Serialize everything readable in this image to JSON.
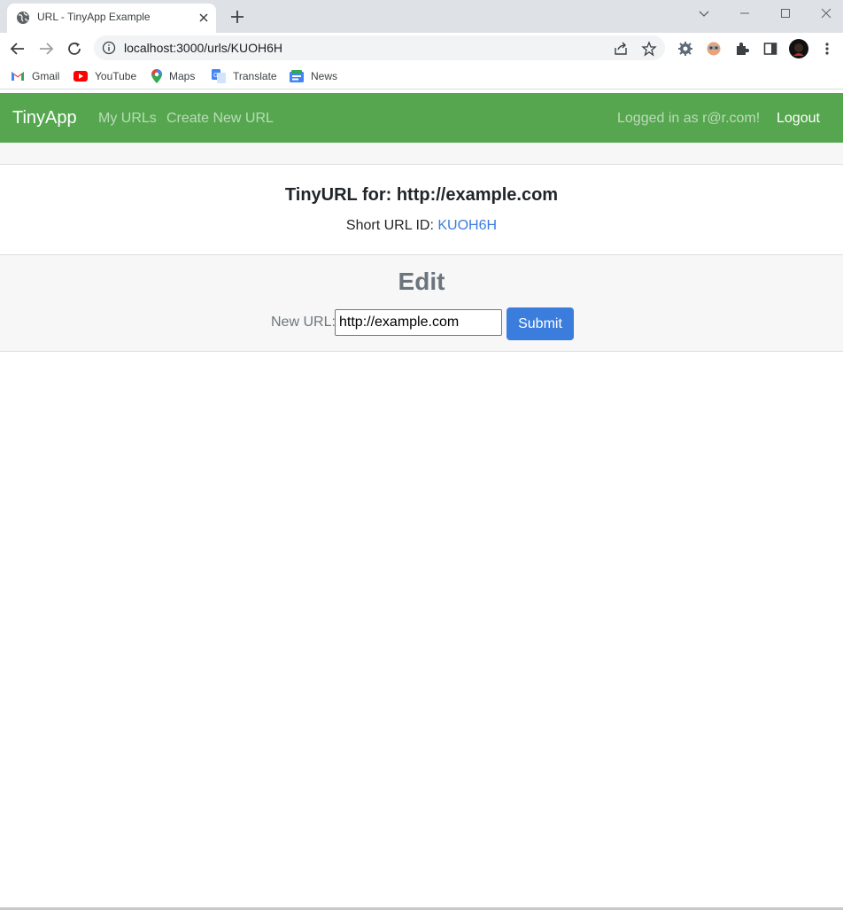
{
  "browser": {
    "tab": {
      "title": "URL - TinyApp Example",
      "favicon": "globe-icon"
    },
    "address_bar": {
      "url": "localhost:3000/urls/KUOH6H"
    },
    "bookmarks": [
      {
        "label": "Gmail",
        "icon": "gmail-icon"
      },
      {
        "label": "YouTube",
        "icon": "youtube-icon"
      },
      {
        "label": "Maps",
        "icon": "maps-icon"
      },
      {
        "label": "Translate",
        "icon": "translate-icon"
      },
      {
        "label": "News",
        "icon": "news-icon"
      }
    ]
  },
  "navbar": {
    "brand": "TinyApp",
    "links": [
      "My URLs",
      "Create New URL"
    ],
    "user_status": "Logged in as r@r.com!",
    "logout": "Logout",
    "color": "#55a64f"
  },
  "card": {
    "title": "TinyURL for: http://example.com",
    "short_label": "Short URL ID:",
    "short_id": "KUOH6H",
    "link_color": "#3b7ddd"
  },
  "edit": {
    "heading": "Edit",
    "label": "New URL:",
    "input_value": "http://example.com",
    "submit": "Submit",
    "button_color": "#3b7ddd"
  }
}
